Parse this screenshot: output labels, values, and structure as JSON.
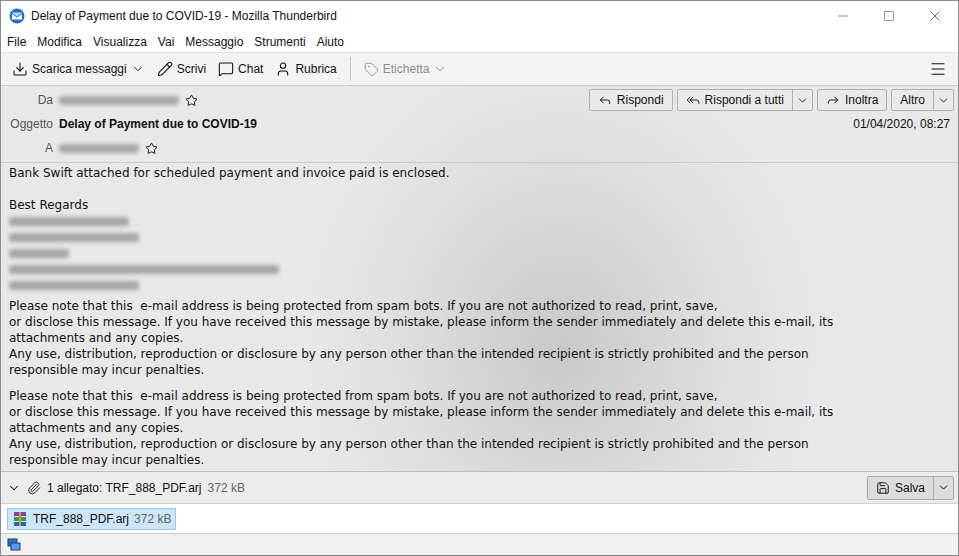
{
  "window": {
    "title": "Delay of Payment due to COVID-19 - Mozilla Thunderbird"
  },
  "menu": [
    "File",
    "Modifica",
    "Visualizza",
    "Vai",
    "Messaggio",
    "Strumenti",
    "Aiuto"
  ],
  "toolbar": {
    "main": [
      {
        "label": "Scarica messaggi",
        "dropdown": true,
        "disabled": false
      },
      {
        "label": "Scrivi",
        "dropdown": false,
        "disabled": false
      },
      {
        "label": "Chat",
        "dropdown": false,
        "disabled": false
      },
      {
        "label": "Rubrica",
        "dropdown": false,
        "disabled": false
      }
    ],
    "extra": [
      {
        "label": "Etichetta",
        "dropdown": true,
        "disabled": true
      }
    ]
  },
  "header": {
    "from_label": "Da",
    "from_starred": false,
    "subject_label": "Oggetto",
    "subject": "Delay of Payment due to COVID-19",
    "to_label": "A",
    "to_starred": false,
    "date": "01/04/2020, 08:27",
    "actions": [
      {
        "label": "Rispondi",
        "dropdown": false
      },
      {
        "label": "Rispondi a tutti",
        "dropdown": true
      },
      {
        "label": "Inoltra",
        "dropdown": false
      },
      {
        "label": "Altro",
        "dropdown": true
      }
    ]
  },
  "body": {
    "intro": "Bank Swift attached for scheduled payment and invoice paid is enclosed.",
    "closing": "Best Regards",
    "disclaimers": [
      [
        "Please note that this  e-mail address is being protected from spam bots. If you are not authorized to read, print, save,",
        "or disclose this message. If you have received this message by mistake, please inform the sender immediately and delete this e-mail, its",
        "attachments and any copies.",
        "Any use, distribution, reproduction or disclosure by any person other than the intended recipient is strictly prohibited and the person",
        "responsible may incur penalties."
      ],
      [
        "Please note that this  e-mail address is being protected from spam bots. If you are not authorized to read, print, save,",
        "or disclose this message. If you have received this message by mistake, please inform the sender immediately and delete this e-mail, its",
        "attachments and any copies.",
        "Any use, distribution, reproduction or disclosure by any person other than the intended recipient is strictly prohibited and the person",
        "responsible may incur penalties."
      ]
    ]
  },
  "attachments": {
    "expanded": true,
    "summary": "1 allegato: TRF_888_PDF.arj",
    "size": "372 kB",
    "save": "Salva",
    "files": [
      {
        "name": "TRF_888_PDF.arj",
        "size": "372 kB",
        "selected": true
      }
    ]
  }
}
